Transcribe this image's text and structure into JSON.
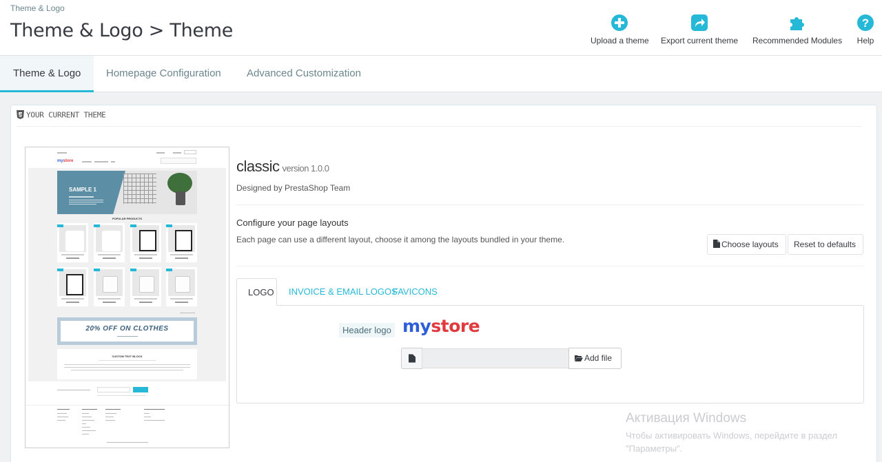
{
  "header": {
    "breadcrumb": "Theme & Logo",
    "title": "Theme & Logo > Theme",
    "toolbar": [
      {
        "label": "Upload a theme",
        "icon": "plus-circle-icon"
      },
      {
        "label": "Export current theme",
        "icon": "share-icon"
      },
      {
        "label": "Recommended Modules",
        "icon": "puzzle-icon"
      },
      {
        "label": "Help",
        "icon": "help-icon"
      }
    ]
  },
  "tabs": [
    {
      "label": "Theme & Logo",
      "active": true
    },
    {
      "label": "Homepage Configuration",
      "active": false
    },
    {
      "label": "Advanced Customization",
      "active": false
    }
  ],
  "panel": {
    "heading": "YOUR CURRENT THEME",
    "theme_name": "classic",
    "theme_version": "version 1.0.0",
    "designed_by": "Designed by PrestaShop Team",
    "configure_title": "Configure your page layouts",
    "configure_desc": "Each page can use a different layout, choose it among the layouts bundled in your theme.",
    "choose_layouts": "Choose layouts",
    "reset_defaults": "Reset to defaults",
    "subtabs": [
      {
        "label": "LOGO",
        "active": true
      },
      {
        "label": "INVOICE & EMAIL LOGOS",
        "active": false
      },
      {
        "label": "FAVICONS",
        "active": false
      }
    ],
    "header_logo_label": "Header logo",
    "logo_text_1": "my",
    "logo_text_2": "store",
    "add_file": "Add file"
  },
  "preview": {
    "sample_title": "SAMPLE 1",
    "popular_products": "POPULAR PRODUCTS",
    "banner": "20% OFF ON CLOTHES",
    "custom_block": "CUSTOM TEXT BLOCK"
  },
  "watermark": {
    "title": "Активация Windows",
    "subtitle": "Чтобы активировать Windows, перейдите в раздел \"Параметры\"."
  },
  "colors": {
    "accent": "#25b9d7",
    "logo_my": "#2f5fd8",
    "logo_store": "#e03a3e"
  }
}
